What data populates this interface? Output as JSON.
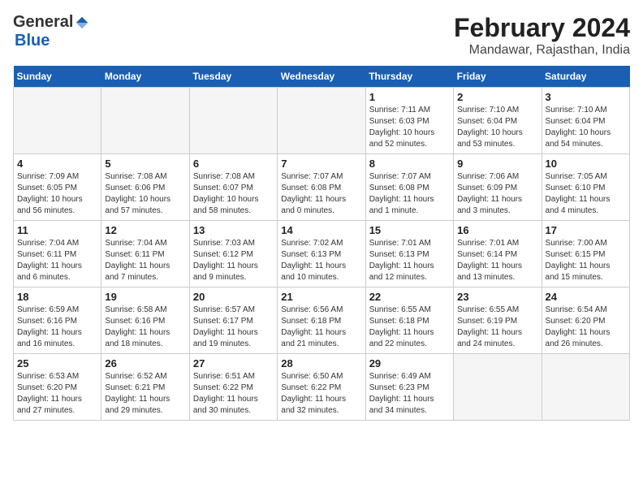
{
  "header": {
    "logo_general": "General",
    "logo_blue": "Blue",
    "month_title": "February 2024",
    "subtitle": "Mandawar, Rajasthan, India"
  },
  "days_of_week": [
    "Sunday",
    "Monday",
    "Tuesday",
    "Wednesday",
    "Thursday",
    "Friday",
    "Saturday"
  ],
  "weeks": [
    [
      {
        "num": "",
        "info": ""
      },
      {
        "num": "",
        "info": ""
      },
      {
        "num": "",
        "info": ""
      },
      {
        "num": "",
        "info": ""
      },
      {
        "num": "1",
        "info": "Sunrise: 7:11 AM\nSunset: 6:03 PM\nDaylight: 10 hours\nand 52 minutes."
      },
      {
        "num": "2",
        "info": "Sunrise: 7:10 AM\nSunset: 6:04 PM\nDaylight: 10 hours\nand 53 minutes."
      },
      {
        "num": "3",
        "info": "Sunrise: 7:10 AM\nSunset: 6:04 PM\nDaylight: 10 hours\nand 54 minutes."
      }
    ],
    [
      {
        "num": "4",
        "info": "Sunrise: 7:09 AM\nSunset: 6:05 PM\nDaylight: 10 hours\nand 56 minutes."
      },
      {
        "num": "5",
        "info": "Sunrise: 7:08 AM\nSunset: 6:06 PM\nDaylight: 10 hours\nand 57 minutes."
      },
      {
        "num": "6",
        "info": "Sunrise: 7:08 AM\nSunset: 6:07 PM\nDaylight: 10 hours\nand 58 minutes."
      },
      {
        "num": "7",
        "info": "Sunrise: 7:07 AM\nSunset: 6:08 PM\nDaylight: 11 hours\nand 0 minutes."
      },
      {
        "num": "8",
        "info": "Sunrise: 7:07 AM\nSunset: 6:08 PM\nDaylight: 11 hours\nand 1 minute."
      },
      {
        "num": "9",
        "info": "Sunrise: 7:06 AM\nSunset: 6:09 PM\nDaylight: 11 hours\nand 3 minutes."
      },
      {
        "num": "10",
        "info": "Sunrise: 7:05 AM\nSunset: 6:10 PM\nDaylight: 11 hours\nand 4 minutes."
      }
    ],
    [
      {
        "num": "11",
        "info": "Sunrise: 7:04 AM\nSunset: 6:11 PM\nDaylight: 11 hours\nand 6 minutes."
      },
      {
        "num": "12",
        "info": "Sunrise: 7:04 AM\nSunset: 6:11 PM\nDaylight: 11 hours\nand 7 minutes."
      },
      {
        "num": "13",
        "info": "Sunrise: 7:03 AM\nSunset: 6:12 PM\nDaylight: 11 hours\nand 9 minutes."
      },
      {
        "num": "14",
        "info": "Sunrise: 7:02 AM\nSunset: 6:13 PM\nDaylight: 11 hours\nand 10 minutes."
      },
      {
        "num": "15",
        "info": "Sunrise: 7:01 AM\nSunset: 6:13 PM\nDaylight: 11 hours\nand 12 minutes."
      },
      {
        "num": "16",
        "info": "Sunrise: 7:01 AM\nSunset: 6:14 PM\nDaylight: 11 hours\nand 13 minutes."
      },
      {
        "num": "17",
        "info": "Sunrise: 7:00 AM\nSunset: 6:15 PM\nDaylight: 11 hours\nand 15 minutes."
      }
    ],
    [
      {
        "num": "18",
        "info": "Sunrise: 6:59 AM\nSunset: 6:16 PM\nDaylight: 11 hours\nand 16 minutes."
      },
      {
        "num": "19",
        "info": "Sunrise: 6:58 AM\nSunset: 6:16 PM\nDaylight: 11 hours\nand 18 minutes."
      },
      {
        "num": "20",
        "info": "Sunrise: 6:57 AM\nSunset: 6:17 PM\nDaylight: 11 hours\nand 19 minutes."
      },
      {
        "num": "21",
        "info": "Sunrise: 6:56 AM\nSunset: 6:18 PM\nDaylight: 11 hours\nand 21 minutes."
      },
      {
        "num": "22",
        "info": "Sunrise: 6:55 AM\nSunset: 6:18 PM\nDaylight: 11 hours\nand 22 minutes."
      },
      {
        "num": "23",
        "info": "Sunrise: 6:55 AM\nSunset: 6:19 PM\nDaylight: 11 hours\nand 24 minutes."
      },
      {
        "num": "24",
        "info": "Sunrise: 6:54 AM\nSunset: 6:20 PM\nDaylight: 11 hours\nand 26 minutes."
      }
    ],
    [
      {
        "num": "25",
        "info": "Sunrise: 6:53 AM\nSunset: 6:20 PM\nDaylight: 11 hours\nand 27 minutes."
      },
      {
        "num": "26",
        "info": "Sunrise: 6:52 AM\nSunset: 6:21 PM\nDaylight: 11 hours\nand 29 minutes."
      },
      {
        "num": "27",
        "info": "Sunrise: 6:51 AM\nSunset: 6:22 PM\nDaylight: 11 hours\nand 30 minutes."
      },
      {
        "num": "28",
        "info": "Sunrise: 6:50 AM\nSunset: 6:22 PM\nDaylight: 11 hours\nand 32 minutes."
      },
      {
        "num": "29",
        "info": "Sunrise: 6:49 AM\nSunset: 6:23 PM\nDaylight: 11 hours\nand 34 minutes."
      },
      {
        "num": "",
        "info": ""
      },
      {
        "num": "",
        "info": ""
      }
    ]
  ]
}
